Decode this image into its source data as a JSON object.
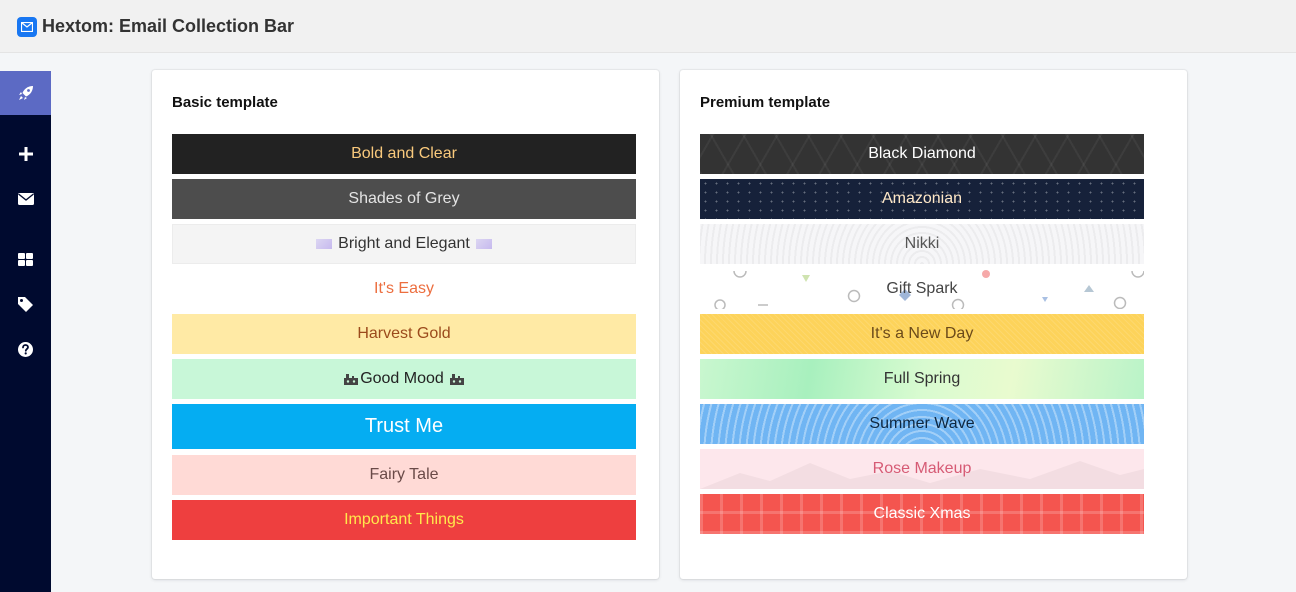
{
  "app": {
    "title": "Hextom: Email Collection Bar"
  },
  "sidebar": {
    "items": [
      {
        "icon": "rocket-icon",
        "active": true
      },
      {
        "icon": "plus-icon",
        "active": false
      },
      {
        "icon": "envelope-icon",
        "active": false
      },
      {
        "icon": "dashboard-icon",
        "active": false
      },
      {
        "icon": "tag-icon",
        "active": false
      },
      {
        "icon": "question-icon",
        "active": false
      }
    ]
  },
  "basic": {
    "title": "Basic template",
    "templates": [
      {
        "label": "Bold and Clear"
      },
      {
        "label": "Shades of Grey"
      },
      {
        "label": "Bright and Elegant"
      },
      {
        "label": "It's Easy"
      },
      {
        "label": "Harvest Gold"
      },
      {
        "label": "Good Mood"
      },
      {
        "label": "Trust Me"
      },
      {
        "label": "Fairy Tale"
      },
      {
        "label": "Important Things"
      }
    ]
  },
  "premium": {
    "title": "Premium template",
    "templates": [
      {
        "label": "Black Diamond"
      },
      {
        "label": "Amazonian"
      },
      {
        "label": "Nikki"
      },
      {
        "label": "Gift Spark"
      },
      {
        "label": "It's a New Day"
      },
      {
        "label": "Full Spring"
      },
      {
        "label": "Summer Wave"
      },
      {
        "label": "Rose Makeup"
      },
      {
        "label": "Classic Xmas"
      }
    ]
  },
  "colors": {
    "sidebar": "#000a2f",
    "sidebar_active": "#5c6ac4",
    "logo": "#1877f2"
  }
}
